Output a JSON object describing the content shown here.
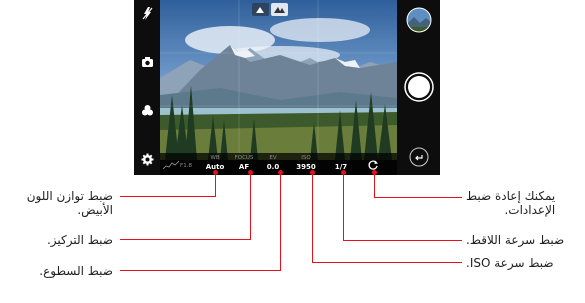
{
  "camera": {
    "histogram_label": "F1.8",
    "params": [
      {
        "label": "WB",
        "value": "Auto"
      },
      {
        "label": "FOCUS",
        "value": "AF"
      },
      {
        "label": "EV",
        "value": "0.0"
      },
      {
        "label": "ISO",
        "value": "3950"
      },
      {
        "label": "",
        "value": "1/7"
      }
    ],
    "icons": [
      "flash-off-icon",
      "camera-mode-icon",
      "effects-icon",
      "settings-icon",
      "gallery-thumbnail",
      "shutter-button",
      "back-icon",
      "reset-icon"
    ]
  },
  "callouts": {
    "wb": [
      "ضبط توازن اللون",
      "الأبيض."
    ],
    "focus": "ضبط التركيز.",
    "ev": "ضبط السطوع.",
    "reset": [
      "يمكنك إعادة ضبط",
      "الإعدادات."
    ],
    "shutter": "ضبط سرعة اللاقط.",
    "iso": "ضبط سرعة ISO."
  },
  "colors": {
    "accent": "#e4121c",
    "bar": "#0d0d0d"
  }
}
